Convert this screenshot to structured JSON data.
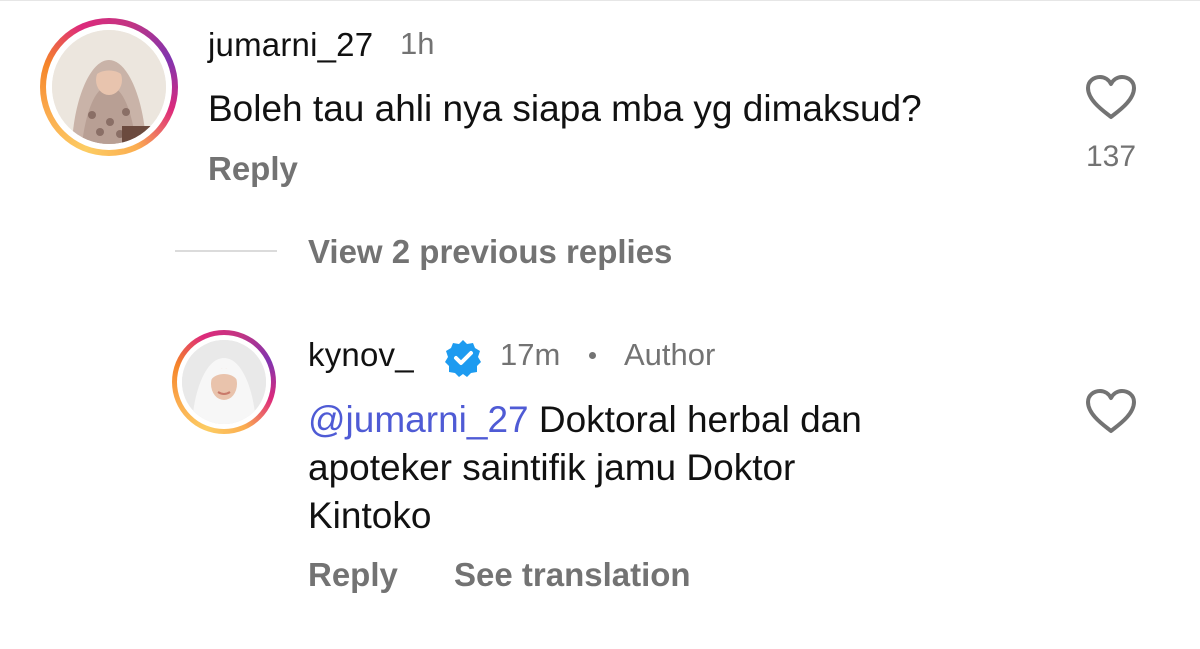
{
  "comment": {
    "username": "jumarni_27",
    "time": "1h",
    "text": "Boleh tau ahli nya siapa mba yg dimaksud?",
    "reply_label": "Reply",
    "likes": "137"
  },
  "view_replies": "View 2 previous replies",
  "reply": {
    "username": "kynov_",
    "time": "17m",
    "separator": "•",
    "author_label": "Author",
    "mention": "@jumarni_27",
    "text_line1": " Doktoral herbal dan",
    "text_line2": "apoteker saintifik jamu Doktor",
    "text_line3": "Kintoko",
    "reply_label": "Reply",
    "translation_label": "See translation"
  },
  "colors": {
    "mention": "#4f5bd5",
    "verified": "#1d9bf0",
    "muted": "#737373"
  }
}
